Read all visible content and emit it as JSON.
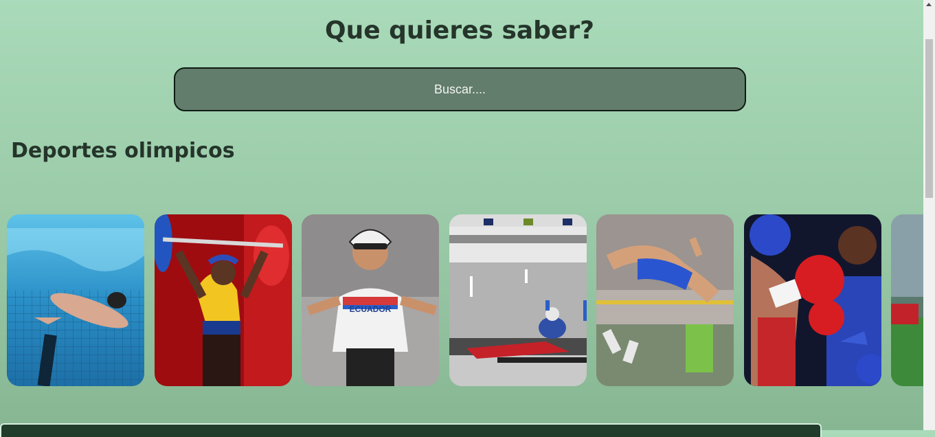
{
  "header": {
    "title": "Que quieres saber?"
  },
  "search": {
    "placeholder": "Buscar...."
  },
  "section": {
    "title": "Deportes olimpicos"
  },
  "sports": [
    {
      "name": "swimming-card",
      "icon": "swimmer-image"
    },
    {
      "name": "weightlifting-card",
      "icon": "weightlifter-image"
    },
    {
      "name": "cycling-card",
      "icon": "cyclist-image"
    },
    {
      "name": "shooting-card",
      "icon": "shooter-image"
    },
    {
      "name": "high-jump-card",
      "icon": "high-jumper-image"
    },
    {
      "name": "boxing-card",
      "icon": "boxer-image"
    },
    {
      "name": "partial-card",
      "icon": "stadium-image"
    }
  ],
  "colors": {
    "background_top": "#a9dab9",
    "background_bottom": "#86b692",
    "search_bg": "#637d6c",
    "heading": "#25352b"
  }
}
